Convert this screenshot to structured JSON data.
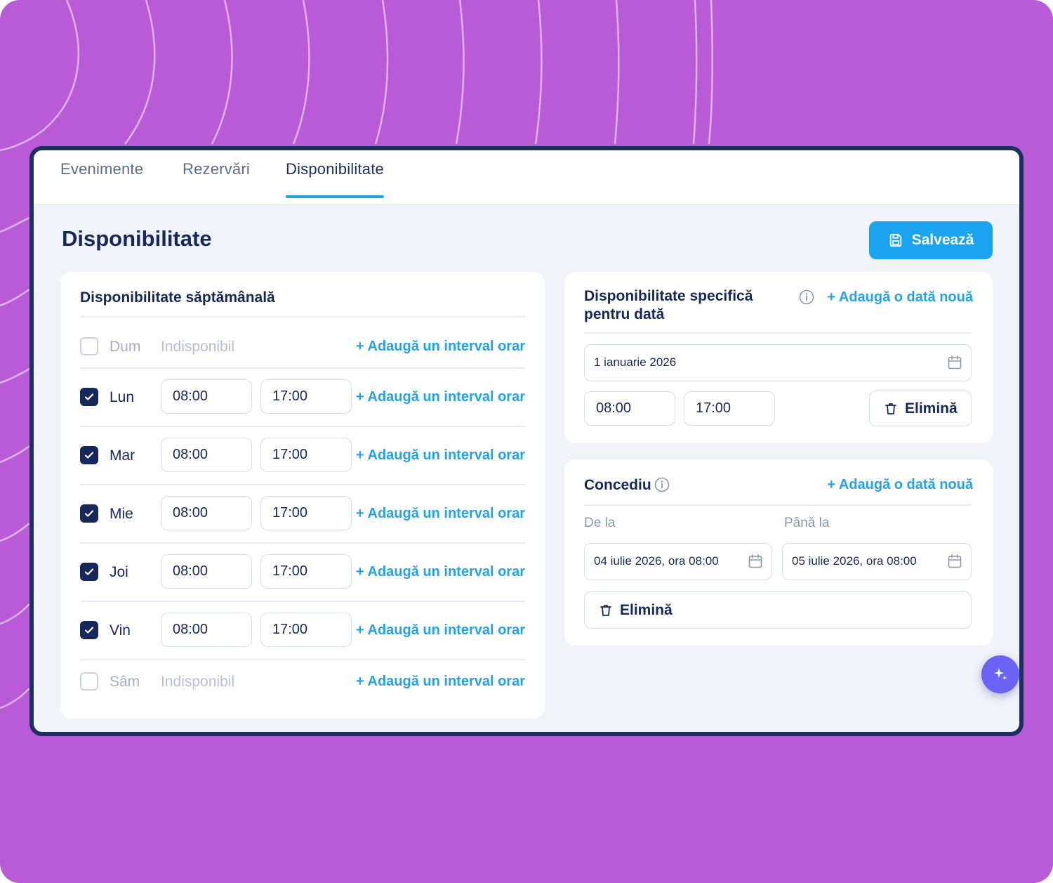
{
  "tabs": [
    {
      "label": "Evenimente",
      "active": false
    },
    {
      "label": "Rezervări",
      "active": false
    },
    {
      "label": "Disponibilitate",
      "active": true
    }
  ],
  "page": {
    "title": "Disponibilitate",
    "save_label": "Salvează",
    "save_icon": "floppy-disk-icon"
  },
  "weekly": {
    "title": "Disponibilitate săptămânală",
    "add_interval_label": "+ Adaugă un interval orar",
    "unavailable_label": "Indisponibil",
    "days": [
      {
        "day": "Dum",
        "checked": false
      },
      {
        "day": "Lun",
        "checked": true,
        "start": "08:00",
        "end": "17:00"
      },
      {
        "day": "Mar",
        "checked": true,
        "start": "08:00",
        "end": "17:00"
      },
      {
        "day": "Mie",
        "checked": true,
        "start": "08:00",
        "end": "17:00"
      },
      {
        "day": "Joi",
        "checked": true,
        "start": "08:00",
        "end": "17:00"
      },
      {
        "day": "Vin",
        "checked": true,
        "start": "08:00",
        "end": "17:00"
      },
      {
        "day": "Sâm",
        "checked": false
      }
    ]
  },
  "specific": {
    "title_line1": "Disponibilitate specifică",
    "title_line2": "pentru dată",
    "add_date_label": "+ Adaugă o dată nouă",
    "date": "1 ianuarie 2026",
    "start": "08:00",
    "end": "17:00",
    "remove_label": "Elimină"
  },
  "leave": {
    "title": "Concediu",
    "add_date_label": "+ Adaugă o dată nouă",
    "from_label": "De la",
    "to_label": "Până la",
    "from_value": "04 iulie 2026, ora 08:00",
    "to_value": "05 iulie 2026, ora 08:00",
    "remove_label": "Elimină"
  },
  "colors": {
    "background": "#b95bd6",
    "frame": "#1b2f60",
    "primary": "#1aa3ef",
    "accent_link": "#22a2ec",
    "heading": "#16285a",
    "fab": "#6b63f5"
  },
  "icons": {
    "fab": "sparkle-icon",
    "calendar": "calendar-icon",
    "trash": "trash-icon",
    "info": "info-icon",
    "check": "check-icon"
  }
}
